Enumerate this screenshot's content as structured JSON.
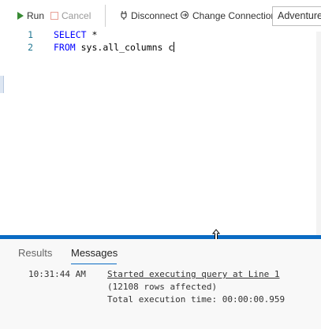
{
  "toolbar": {
    "run_label": "Run",
    "cancel_label": "Cancel",
    "disconnect_label": "Disconnect",
    "change_connection_label": "Change Connection",
    "database_value": "AdventureWorks"
  },
  "editor": {
    "lines": [
      {
        "number": "1",
        "keyword": "SELECT",
        "text": " *"
      },
      {
        "number": "2",
        "keyword": "FROM",
        "text": " sys.all_columns c"
      }
    ]
  },
  "results_panel": {
    "tabs": {
      "results": "Results",
      "messages": "Messages"
    },
    "messages": {
      "time": "10:31:44 AM",
      "started": "Started executing query at Line 1",
      "rows": "(12108 rows affected)",
      "total": "Total execution time: 00:00:00.959"
    }
  },
  "colors": {
    "accent": "#0a6bc4",
    "keyword": "#0000ff",
    "line_number": "#237893",
    "run_icon": "#388a34"
  }
}
